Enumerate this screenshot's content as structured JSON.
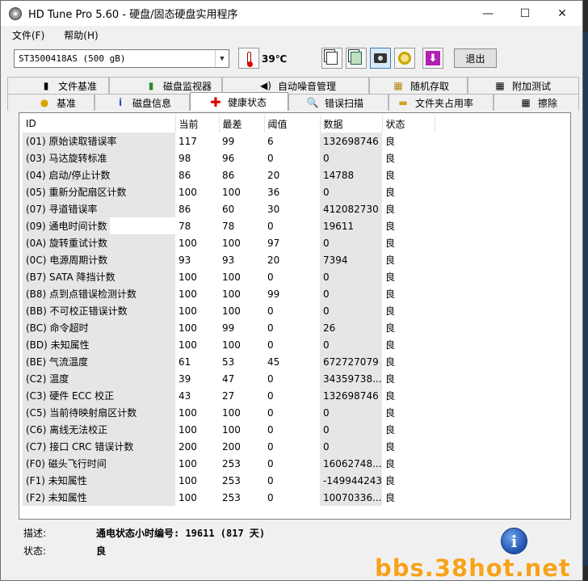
{
  "window": {
    "title": "HD Tune Pro 5.60 - 硬盘/固态硬盘实用程序",
    "min": "—",
    "max": "☐",
    "close": "✕"
  },
  "menu": [
    "文件(F)",
    "帮助(H)"
  ],
  "toolbar": {
    "drive": "ST3500418AS (500 gB)",
    "temperature": "39℃",
    "exit_label": "退出"
  },
  "tabs": {
    "row1": [
      {
        "label": "文件基准",
        "icon": "file-benchmark-icon"
      },
      {
        "label": "磁盘监视器",
        "icon": "disk-monitor-icon"
      },
      {
        "label": "自动噪音管理",
        "icon": "speaker-icon"
      },
      {
        "label": "随机存取",
        "icon": "random-access-icon"
      },
      {
        "label": "附加测试",
        "icon": "extra-tests-icon"
      }
    ],
    "row2": [
      {
        "label": "基准",
        "icon": "benchmark-icon"
      },
      {
        "label": "磁盘信息",
        "icon": "info-icon"
      },
      {
        "label": "健康状态",
        "icon": "health-cross-icon"
      },
      {
        "label": "错误扫描",
        "icon": "magnifier-icon"
      },
      {
        "label": "文件夹占用率",
        "icon": "folder-icon"
      },
      {
        "label": "擦除",
        "icon": "erase-icon"
      }
    ],
    "active": "健康状态"
  },
  "table": {
    "headers": [
      "ID",
      "当前",
      "最差",
      "阈值",
      "数据",
      "状态"
    ],
    "rows": [
      [
        "(01) 原始读取错误率",
        "117",
        "99",
        "6",
        "132698746",
        "良"
      ],
      [
        "(03) 马达旋转标准",
        "98",
        "96",
        "0",
        "0",
        "良"
      ],
      [
        "(04) 启动/停止计数",
        "86",
        "86",
        "20",
        "14788",
        "良"
      ],
      [
        "(05) 重新分配扇区计数",
        "100",
        "100",
        "36",
        "0",
        "良"
      ],
      [
        "(07) 寻道错误率",
        "86",
        "60",
        "30",
        "412082730",
        "良"
      ],
      [
        "(09) 通电时间计数",
        "78",
        "78",
        "0",
        "19611",
        "良"
      ],
      [
        "(0A) 旋转重试计数",
        "100",
        "100",
        "97",
        "0",
        "良"
      ],
      [
        "(0C) 电源周期计数",
        "93",
        "93",
        "20",
        "7394",
        "良"
      ],
      [
        "(B7) SATA 降挡计数",
        "100",
        "100",
        "0",
        "0",
        "良"
      ],
      [
        "(B8) 点到点错误检测计数",
        "100",
        "100",
        "99",
        "0",
        "良"
      ],
      [
        "(BB) 不可校正错误计数",
        "100",
        "100",
        "0",
        "0",
        "良"
      ],
      [
        "(BC) 命令超时",
        "100",
        "99",
        "0",
        "26",
        "良"
      ],
      [
        "(BD) 未知属性",
        "100",
        "100",
        "0",
        "0",
        "良"
      ],
      [
        "(BE) 气流温度",
        "61",
        "53",
        "45",
        "672727079",
        "良"
      ],
      [
        "(C2) 温度",
        "39",
        "47",
        "0",
        "34359738...",
        "良"
      ],
      [
        "(C3) 硬件 ECC 校正",
        "43",
        "27",
        "0",
        "132698746",
        "良"
      ],
      [
        "(C5) 当前待映射扇区计数",
        "100",
        "100",
        "0",
        "0",
        "良"
      ],
      [
        "(C6) 离线无法校正",
        "100",
        "100",
        "0",
        "0",
        "良"
      ],
      [
        "(C7) 接口 CRC 错误计数",
        "200",
        "200",
        "0",
        "0",
        "良"
      ],
      [
        "(F0) 磁头飞行时间",
        "100",
        "253",
        "0",
        "16062748...",
        "良"
      ],
      [
        "(F1) 未知属性",
        "100",
        "253",
        "0",
        "-149944243",
        "良"
      ],
      [
        "(F2) 未知属性",
        "100",
        "253",
        "0",
        "10070336...",
        "良"
      ]
    ]
  },
  "description": {
    "desc_label": "描述:",
    "desc_value": "通电状态小时编号: 19611 (817 天)",
    "status_label": "状态:",
    "status_value": "良"
  },
  "info_button": "i",
  "watermark": "bbs.38hot.net"
}
